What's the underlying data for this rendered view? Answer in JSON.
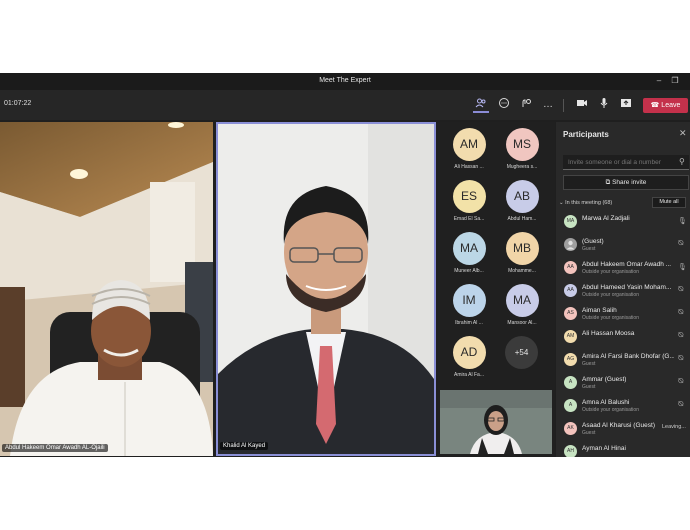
{
  "window": {
    "title": "Meet The Expert"
  },
  "toolbar": {
    "timer": "01:07:22",
    "leave_label": "Leave"
  },
  "video": {
    "tile1_name": "Abdul Hakeem Omar Awadh AL-Ojaili",
    "tile2_name": "Khalid Al Kayed"
  },
  "gallery": {
    "avatars": [
      {
        "initials": "AM",
        "label": "Ali Hassan ...",
        "color": "#f2dcae"
      },
      {
        "initials": "MS",
        "label": "Mugheera s...",
        "color": "#f0c6c0"
      },
      {
        "initials": "ES",
        "label": "Emad El Sa...",
        "color": "#f2e2a8"
      },
      {
        "initials": "AB",
        "label": "Abdul Ham...",
        "color": "#c8cce8"
      },
      {
        "initials": "MA",
        "label": "Muneer Alb...",
        "color": "#bcd7e6"
      },
      {
        "initials": "MB",
        "label": "Mohamme...",
        "color": "#f1d5a8"
      },
      {
        "initials": "IM",
        "label": "Ibrahim Al ...",
        "color": "#bcd4ea"
      },
      {
        "initials": "MA",
        "label": "Mansoor Al...",
        "color": "#c8cce8"
      },
      {
        "initials": "AD",
        "label": "Amira Al Fa...",
        "color": "#f2dcae"
      }
    ],
    "more_count": "+54"
  },
  "panel": {
    "title": "Participants",
    "invite_placeholder": "Invite someone or dial a number",
    "share_invite": "Share invite",
    "section_label": "In this meeting (68)",
    "mute_all": "Mute all",
    "participants": [
      {
        "initials": "MA",
        "name": "Marwa Al Zadjali",
        "sub": "",
        "status": "",
        "color": "#c7e3c2"
      },
      {
        "initials": "",
        "name": "(Guest)",
        "sub": "Guest",
        "status": "",
        "color": "#9e9e9e"
      },
      {
        "initials": "AA",
        "name": "Abdul Hakeem Omar Awadh ...",
        "sub": "Outside your organisation",
        "status": "",
        "color": "#f3c3bd"
      },
      {
        "initials": "AA",
        "name": "Abdul Hameed Yasin Moham...",
        "sub": "Outside your organisation",
        "status": "",
        "color": "#c8cce8"
      },
      {
        "initials": "AS",
        "name": "Aiman Salih",
        "sub": "Outside your organisation",
        "status": "",
        "color": "#f3c3bd"
      },
      {
        "initials": "AM",
        "name": "Ali Hassan Moosa",
        "sub": "",
        "status": "",
        "color": "#f2dcae"
      },
      {
        "initials": "AG",
        "name": "Amira Al Farsi Bank Dhofar (G...",
        "sub": "Guest",
        "status": "",
        "color": "#f2dcae"
      },
      {
        "initials": "A",
        "name": "Ammar (Guest)",
        "sub": "Guest",
        "status": "",
        "color": "#c7e3c2"
      },
      {
        "initials": "A",
        "name": "Amna Al Balushi",
        "sub": "Outside your organisation",
        "status": "",
        "color": "#c7e3c2"
      },
      {
        "initials": "AK",
        "name": "Asaad Al Kharusi (Guest)",
        "sub": "Guest",
        "status": "Leaving...",
        "color": "#f3c3bd"
      },
      {
        "initials": "AH",
        "name": "Ayman Al Hinai",
        "sub": "",
        "status": "",
        "color": "#c7e3c2"
      }
    ]
  }
}
